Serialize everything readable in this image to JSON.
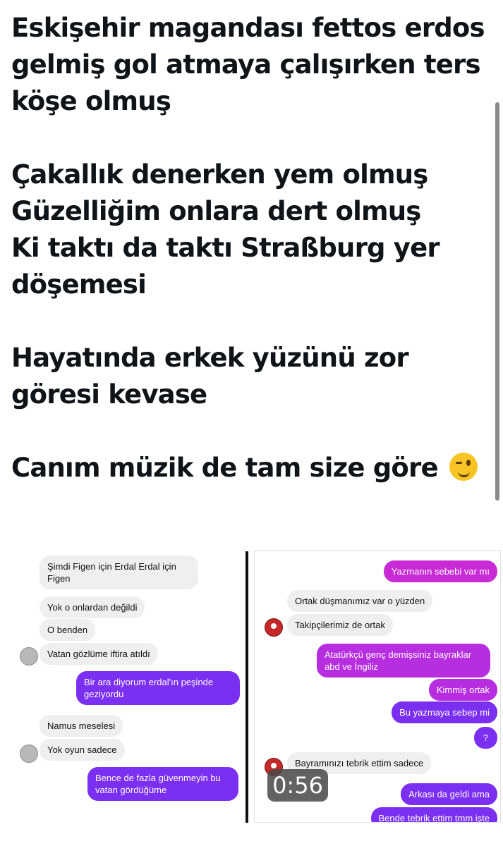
{
  "tweet": {
    "lines": [
      "Eskişehir magandası fettos erdos gelmiş gol atmaya çalışırken ters köşe olmuş",
      "Çakallık denerken yem olmuş",
      "Güzelliğim onlara dert olmuş",
      "Ki taktı da taktı Straßburg yer döşemesi",
      "Hayatında erkek yüzünü zor göresi kevase",
      "Canım müzik de tam size göre"
    ],
    "emoji_icon": "winking-face-emoji"
  },
  "left_chat": {
    "messages": [
      {
        "text": "Şimdi Figen için Erdal Erdal için Figen",
        "side": "in"
      },
      {
        "text": "Yok o onlardan değildi",
        "side": "in"
      },
      {
        "text": "O benden",
        "side": "in"
      },
      {
        "text": "Vatan gözlüme iftira atıldı",
        "side": "in"
      },
      {
        "text": "Bir ara diyorum erdal'ın peşinde geziyordu",
        "side": "out"
      },
      {
        "text": "Namus meselesi",
        "side": "in"
      },
      {
        "text": "Yok oyun sadece",
        "side": "in"
      },
      {
        "text": "Bence de fazla güvenmeyin bu vatan gördüğüme",
        "side": "out"
      }
    ]
  },
  "right_chat": {
    "messages": [
      {
        "text": "Yazmanın sebebi var mı",
        "side": "out"
      },
      {
        "text": "Ortak düşmanımız var o yüzden",
        "side": "in"
      },
      {
        "text": "Takipçilerimiz de ortak",
        "side": "in"
      },
      {
        "text": "Atatürkçü genç demişsiniz bayraklar abd ve İngiliz",
        "side": "out"
      },
      {
        "text": "Kimmiş ortak",
        "side": "out"
      },
      {
        "text": "Bu yazmaya sebep mi",
        "side": "out"
      },
      {
        "text": "?",
        "side": "out"
      },
      {
        "text": "Bayramınızı tebrik ettim sadece",
        "side": "in"
      },
      {
        "text": "Arkası da geldi ama",
        "side": "out"
      },
      {
        "text": "Bende tebrik ettim tmm işte",
        "side": "out"
      }
    ],
    "video_timer": "0:56"
  },
  "colors": {
    "text": "#0f1419",
    "outgoing_bubble": "#7b2ff0",
    "incoming_bubble": "#efefef"
  }
}
